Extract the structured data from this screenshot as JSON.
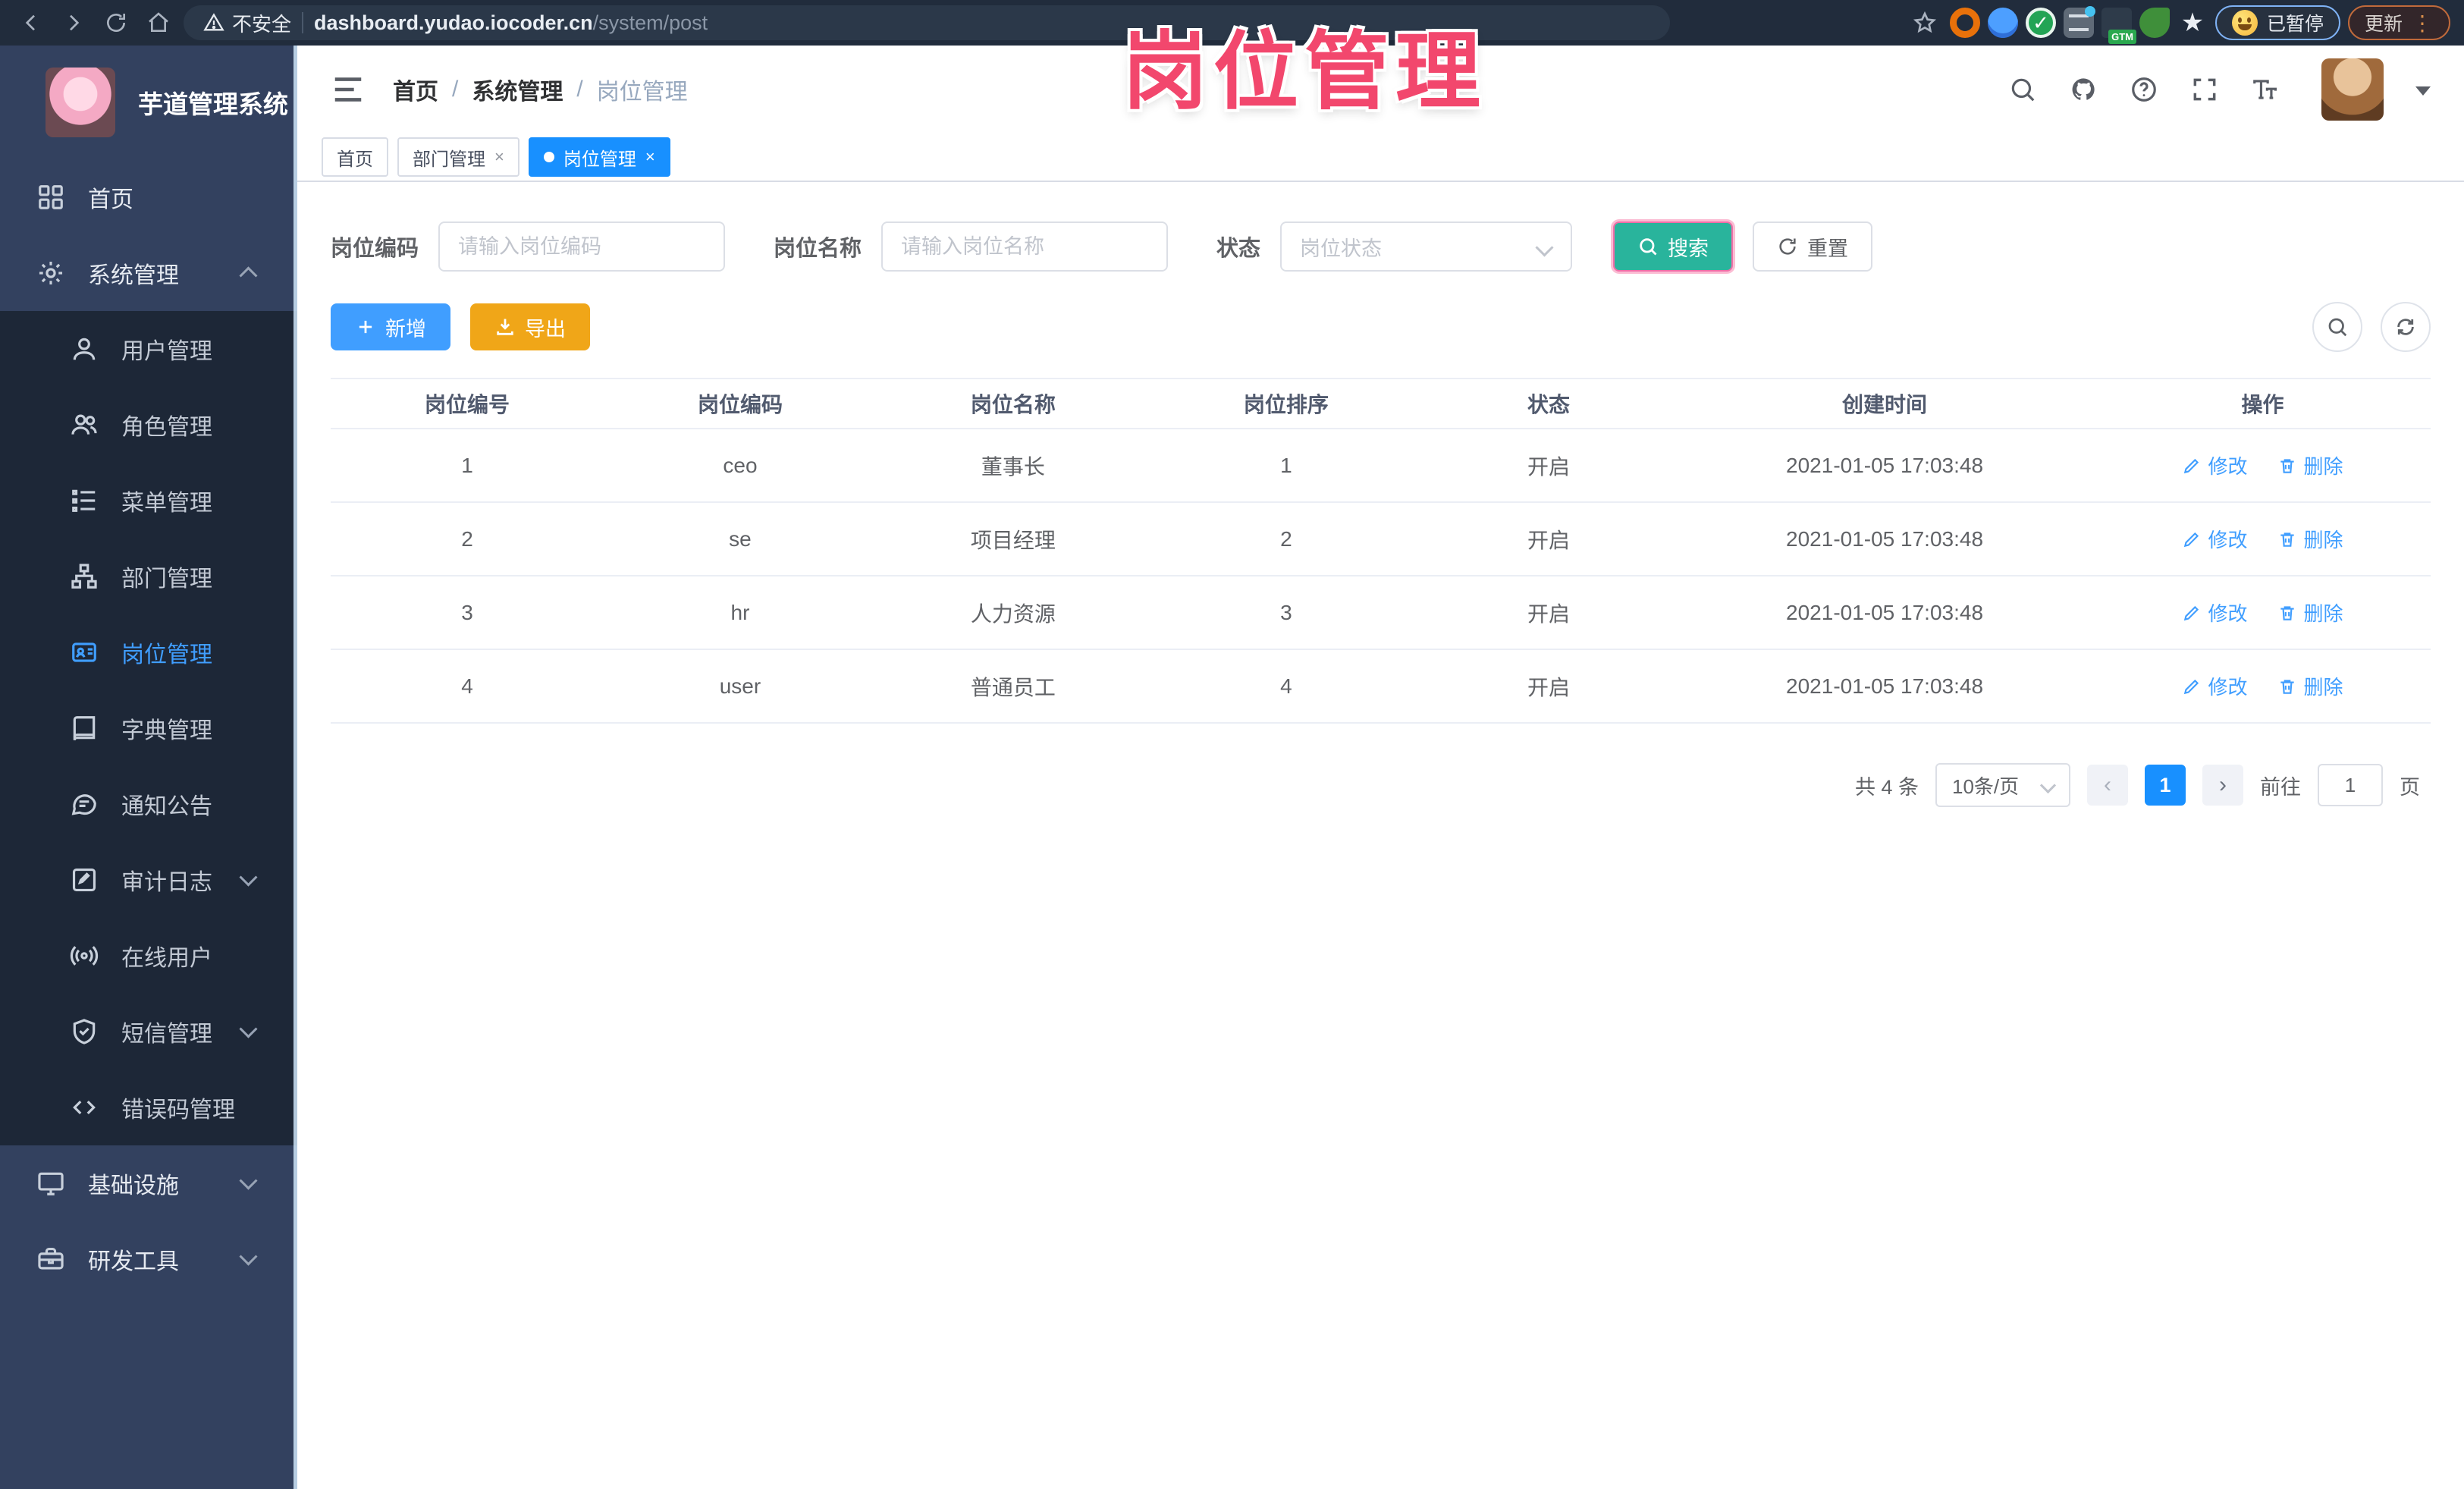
{
  "browser": {
    "security_label": "不安全",
    "url_host": "dashboard.yudao.iocoder.cn",
    "url_path": "/system/post",
    "extension_badge": "GTM",
    "paused_label": "已暂停",
    "update_label": "更新",
    "menu_dots": "⋮"
  },
  "annotation": {
    "title": "岗位管理",
    "color": "#f2476d"
  },
  "sidebar": {
    "app_title": "芋道管理系统",
    "menu": [
      {
        "label": "首页",
        "icon": "dashboard-icon",
        "level": 1
      },
      {
        "label": "系统管理",
        "icon": "gear-icon",
        "level": 1,
        "arrow": "up"
      },
      {
        "label": "用户管理",
        "icon": "user-icon",
        "level": 2
      },
      {
        "label": "角色管理",
        "icon": "users-icon",
        "level": 2
      },
      {
        "label": "菜单管理",
        "icon": "menu-list-icon",
        "level": 2
      },
      {
        "label": "部门管理",
        "icon": "org-tree-icon",
        "level": 2
      },
      {
        "label": "岗位管理",
        "icon": "post-badge-icon",
        "level": 2,
        "active": true
      },
      {
        "label": "字典管理",
        "icon": "dictionary-icon",
        "level": 2
      },
      {
        "label": "通知公告",
        "icon": "announcement-icon",
        "level": 2
      },
      {
        "label": "审计日志",
        "icon": "audit-log-icon",
        "level": 2,
        "arrow": "down"
      },
      {
        "label": "在线用户",
        "icon": "online-user-icon",
        "level": 2
      },
      {
        "label": "短信管理",
        "icon": "sms-shield-icon",
        "level": 2,
        "arrow": "down"
      },
      {
        "label": "错误码管理",
        "icon": "error-code-icon",
        "level": 2
      },
      {
        "label": "基础设施",
        "icon": "infrastructure-icon",
        "level": 1,
        "arrow": "down"
      },
      {
        "label": "研发工具",
        "icon": "devtools-icon",
        "level": 1,
        "arrow": "down"
      }
    ]
  },
  "header": {
    "breadcrumb": [
      "首页",
      "系统管理",
      "岗位管理"
    ],
    "tabs": [
      {
        "label": "首页",
        "closable": false,
        "active": false
      },
      {
        "label": "部门管理",
        "closable": true,
        "active": false
      },
      {
        "label": "岗位管理",
        "closable": true,
        "active": true
      }
    ],
    "close_glyph": "×"
  },
  "filters": {
    "post_code_label": "岗位编码",
    "post_code_placeholder": "请输入岗位编码",
    "post_name_label": "岗位名称",
    "post_name_placeholder": "请输入岗位名称",
    "status_label": "状态",
    "status_placeholder": "岗位状态",
    "search_label": "搜索",
    "reset_label": "重置"
  },
  "toolbar": {
    "add_label": "新增",
    "export_label": "导出"
  },
  "table": {
    "columns": [
      "岗位编号",
      "岗位编码",
      "岗位名称",
      "岗位排序",
      "状态",
      "创建时间",
      "操作"
    ],
    "rows": [
      {
        "id": "1",
        "code": "ceo",
        "name": "董事长",
        "sort": "1",
        "status": "开启",
        "created": "2021-01-05 17:03:48"
      },
      {
        "id": "2",
        "code": "se",
        "name": "项目经理",
        "sort": "2",
        "status": "开启",
        "created": "2021-01-05 17:03:48"
      },
      {
        "id": "3",
        "code": "hr",
        "name": "人力资源",
        "sort": "3",
        "status": "开启",
        "created": "2021-01-05 17:03:48"
      },
      {
        "id": "4",
        "code": "user",
        "name": "普通员工",
        "sort": "4",
        "status": "开启",
        "created": "2021-01-05 17:03:48"
      }
    ],
    "edit_label": "修改",
    "delete_label": "删除"
  },
  "pagination": {
    "total_text": "共 4 条",
    "page_size": "10条/页",
    "prev_glyph": "‹",
    "next_glyph": "›",
    "current_page": "1",
    "goto_label": "前往",
    "goto_value": "1",
    "page_unit": "页"
  },
  "colors": {
    "accent_blue": "#409eff",
    "active_tab_blue": "#1890ff",
    "search_teal": "#29b49c",
    "export_orange": "#f0a618",
    "annotation_pink": "#f2476d",
    "sidebar_navy": "#33415f",
    "submenu_dark": "#1d2737"
  }
}
